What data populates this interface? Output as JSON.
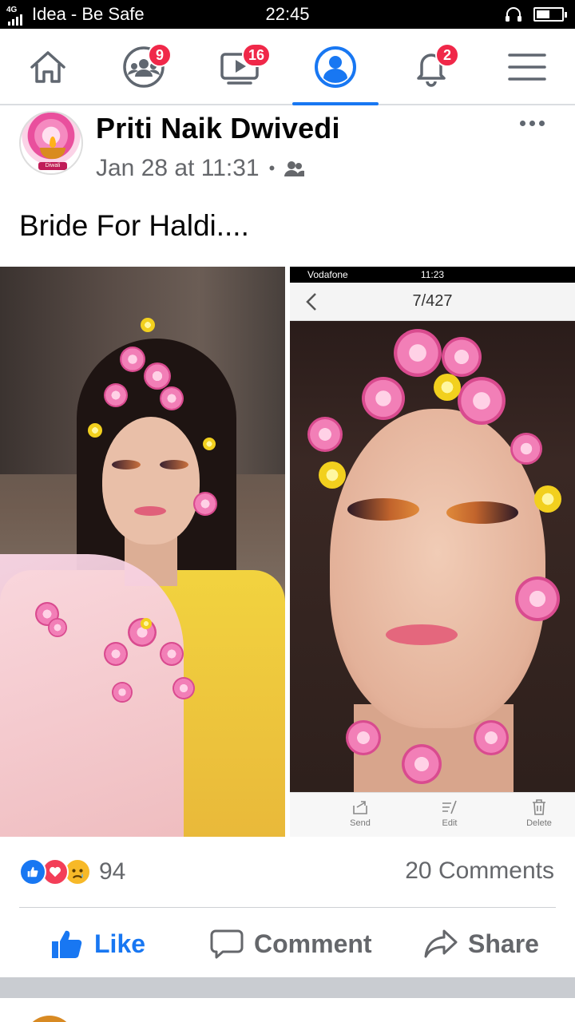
{
  "status_bar": {
    "network": "4G",
    "carrier": "Idea - Be Safe",
    "time": "22:45"
  },
  "nav": {
    "items": [
      {
        "name": "home",
        "icon": "home-icon",
        "badge": ""
      },
      {
        "name": "groups",
        "icon": "groups-icon",
        "badge": "9"
      },
      {
        "name": "watch",
        "icon": "video-icon",
        "badge": "16"
      },
      {
        "name": "profile",
        "icon": "profile-icon",
        "badge": "",
        "active": true
      },
      {
        "name": "notifications",
        "icon": "bell-icon",
        "badge": "2"
      },
      {
        "name": "menu",
        "icon": "hamburger-menu-icon",
        "badge": ""
      }
    ],
    "accent": "#1877f2",
    "badge_color": "#f02849"
  },
  "post": {
    "author": "Priti Naik Dwivedi",
    "timestamp": "Jan 28 at 11:31",
    "separator": "•",
    "audience_icon": "friends-icon",
    "avatar_label": "Diwali",
    "caption": "Bride For Haldi....",
    "screenshot_overlay": {
      "carrier": "Vodafone",
      "time": "11:23",
      "counter": "7/427",
      "actions": [
        "Send",
        "Edit",
        "Delete"
      ]
    },
    "reactions": {
      "icons": [
        "like-reaction-icon",
        "love-reaction-icon",
        "sad-reaction-icon"
      ],
      "count": "94"
    },
    "comments": "20 Comments",
    "actions": {
      "like": "Like",
      "comment": "Comment",
      "share": "Share"
    }
  }
}
